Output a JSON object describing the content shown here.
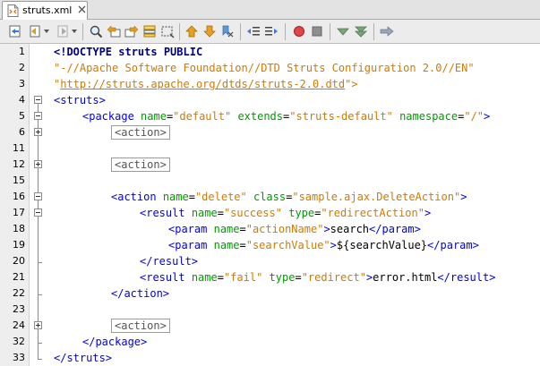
{
  "tab": {
    "filename": "struts.xml",
    "icon": "xml-file-icon"
  },
  "toolbar": {
    "icons": [
      "last-edit-icon",
      "back-icon",
      "forward-icon",
      "find-selection-icon",
      "find-previous-icon",
      "find-next-icon",
      "toggle-highlight-icon",
      "toggle-rect-select-icon",
      "previous-bookmark-icon",
      "next-bookmark-icon",
      "toggle-bookmark-icon",
      "shift-left-icon",
      "shift-right-icon",
      "start-macro-icon",
      "stop-macro-icon",
      "check-xml-icon",
      "validate-xml-icon",
      "xsl-transform-icon"
    ]
  },
  "lines": [
    {
      "num": "1"
    },
    {
      "num": "2"
    },
    {
      "num": "3"
    },
    {
      "num": "4"
    },
    {
      "num": "5"
    },
    {
      "num": "6"
    },
    {
      "num": "11"
    },
    {
      "num": "12"
    },
    {
      "num": "15"
    },
    {
      "num": "16"
    },
    {
      "num": "17"
    },
    {
      "num": "18"
    },
    {
      "num": "19"
    },
    {
      "num": "20"
    },
    {
      "num": "21"
    },
    {
      "num": "22"
    },
    {
      "num": "23"
    },
    {
      "num": "24"
    },
    {
      "num": "32"
    },
    {
      "num": "33"
    }
  ],
  "code": {
    "l1": "<!DOCTYPE struts PUBLIC",
    "l2": "\"-//Apache Software Foundation//DTD Struts Configuration 2.0//EN\"",
    "l3_q1": "\"",
    "l3_url": "http://struts.apache.org/dtds/struts-2.0.dtd",
    "l3_q2": "\">",
    "l4": "<struts>",
    "l5_open": "<package",
    "l5_a1": "name",
    "l5_v1": "\"default\"",
    "l5_a2": "extends",
    "l5_v2": "\"struts-default\"",
    "l5_a3": "namespace",
    "l5_v3": "\"/\"",
    "l5_close": ">",
    "collapsed": "<action>",
    "l16_open": "<action",
    "l16_a1": "name",
    "l16_v1": "\"delete\"",
    "l16_a2": "class",
    "l16_v2": "\"sample.ajax.DeleteAction\"",
    "l16_close": ">",
    "l17_open": "<result",
    "l17_a1": "name",
    "l17_v1": "\"success\"",
    "l17_a2": "type",
    "l17_v2": "\"redirectAction\"",
    "l17_close": ">",
    "l18_open": "<param",
    "l18_a1": "name",
    "l18_v1": "\"actionName\"",
    "l18_gt": ">",
    "l18_text": "search",
    "l18_end": "</param>",
    "l19_open": "<param",
    "l19_a1": "name",
    "l19_v1": "\"searchValue\"",
    "l19_gt": ">",
    "l19_text": "${searchValue}",
    "l19_end": "</param>",
    "l20": "</result>",
    "l21_open": "<result",
    "l21_a1": "name",
    "l21_v1": "\"fail\"",
    "l21_a2": "type",
    "l21_v2": "\"redirect\"",
    "l21_gt": ">",
    "l21_text": "error.html",
    "l21_end": "</result>",
    "l22": "</action>",
    "l32": "</package>",
    "l33": "</struts>"
  }
}
